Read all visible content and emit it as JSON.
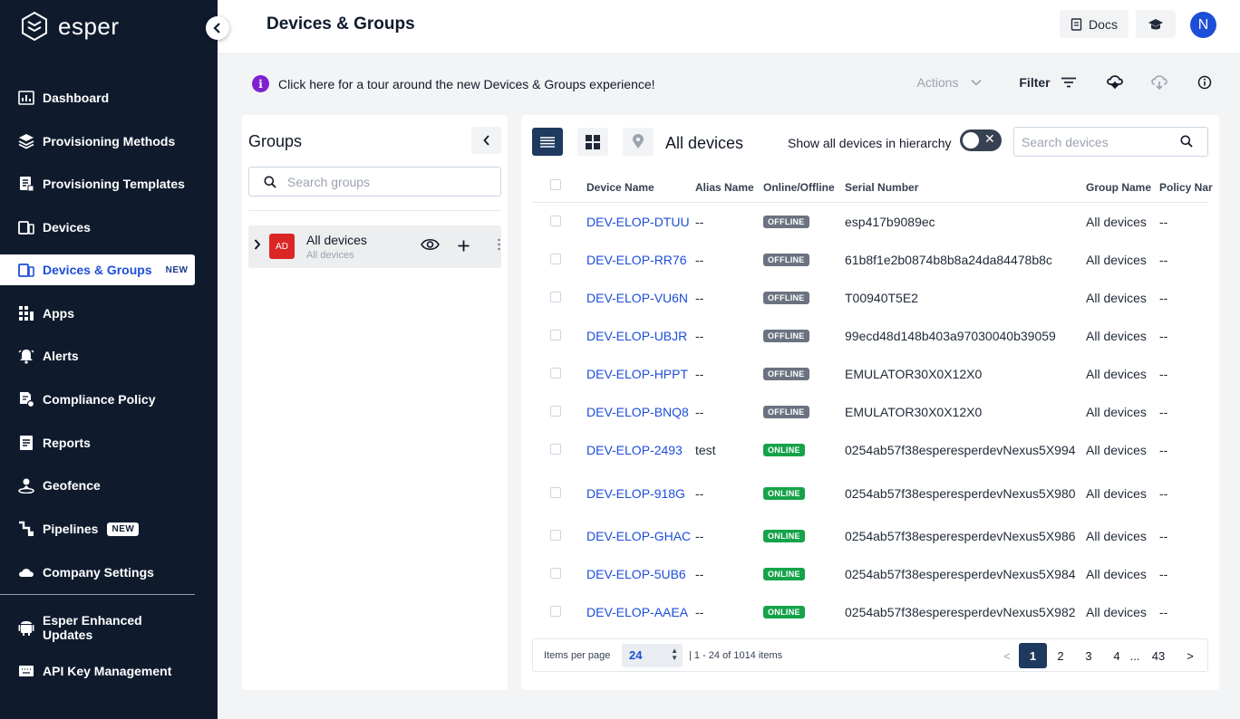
{
  "sidebar": {
    "logo": "esper",
    "items": [
      {
        "label": "Dashboard",
        "icon": "dashboard-icon"
      },
      {
        "label": "Provisioning Methods",
        "icon": "layers-icon"
      },
      {
        "label": "Provisioning Templates",
        "icon": "template-icon"
      },
      {
        "label": "Devices",
        "icon": "devices-icon"
      },
      {
        "label": "Devices & Groups",
        "icon": "devices-groups-icon",
        "badge": "NEW",
        "active": true
      },
      {
        "label": "Apps",
        "icon": "apps-icon"
      },
      {
        "label": "Alerts",
        "icon": "bell-icon"
      },
      {
        "label": "Compliance Policy",
        "icon": "policy-icon"
      },
      {
        "label": "Reports",
        "icon": "reports-icon"
      },
      {
        "label": "Geofence",
        "icon": "geofence-icon"
      },
      {
        "label": "Pipelines",
        "icon": "pipelines-icon",
        "badge": "NEW"
      },
      {
        "label": "Company Settings",
        "icon": "cloud-icon"
      }
    ],
    "bottom_items": [
      {
        "label": "Esper Enhanced Updates",
        "icon": "android-icon"
      },
      {
        "label": "API Key Management",
        "icon": "keyboard-icon"
      }
    ]
  },
  "header": {
    "title": "Devices & Groups",
    "docs_label": "Docs",
    "avatar_initial": "N"
  },
  "toolbar": {
    "tour_text": "Click here for a tour around the new Devices & Groups experience!",
    "actions_label": "Actions",
    "filter_label": "Filter"
  },
  "groups": {
    "title": "Groups",
    "search_placeholder": "Search groups",
    "items": [
      {
        "avatar": "AD",
        "name": "All devices",
        "sub": "All devices"
      }
    ]
  },
  "devices": {
    "title": "All devices",
    "hierarchy_label": "Show all devices in hierarchy",
    "search_placeholder": "Search devices",
    "columns": [
      "Device Name",
      "Alias Name",
      "Online/Offline",
      "Serial Number",
      "Group Name",
      "Policy Nar"
    ],
    "rows": [
      {
        "name": "DEV-ELOP-DTUU",
        "alias": "--",
        "status": "OFFLINE",
        "serial": "esp417b9089ec",
        "group": "All devices",
        "policy": "--"
      },
      {
        "name": "DEV-ELOP-RR76",
        "alias": "--",
        "status": "OFFLINE",
        "serial": "61b8f1e2b0874b8b8a24da84478b8c",
        "group": "All devices",
        "policy": "--"
      },
      {
        "name": "DEV-ELOP-VU6N",
        "alias": "--",
        "status": "OFFLINE",
        "serial": "T00940T5E2",
        "group": "All devices",
        "policy": "--"
      },
      {
        "name": "DEV-ELOP-UBJR",
        "alias": "--",
        "status": "OFFLINE",
        "serial": "99ecd48d148b403a97030040b39059",
        "group": "All devices",
        "policy": "--"
      },
      {
        "name": "DEV-ELOP-HPPT",
        "alias": "--",
        "status": "OFFLINE",
        "serial": "EMULATOR30X0X12X0",
        "group": "All devices",
        "policy": "--"
      },
      {
        "name": "DEV-ELOP-BNQ8",
        "alias": "--",
        "status": "OFFLINE",
        "serial": "EMULATOR30X0X12X0",
        "group": "All devices",
        "policy": "--"
      },
      {
        "name": "DEV-ELOP-2493",
        "alias": "test",
        "status": "ONLINE",
        "serial": "0254ab57f38esperesperdevNexus5X994",
        "group": "All devices",
        "policy": "--"
      },
      {
        "name": "DEV-ELOP-918G",
        "alias": "--",
        "status": "ONLINE",
        "serial": "0254ab57f38esperesperdevNexus5X980",
        "group": "All devices",
        "policy": "--"
      },
      {
        "name": "DEV-ELOP-GHAC",
        "alias": "--",
        "status": "ONLINE",
        "serial": "0254ab57f38esperesperdevNexus5X986",
        "group": "All devices",
        "policy": "--"
      },
      {
        "name": "DEV-ELOP-5UB6",
        "alias": "--",
        "status": "ONLINE",
        "serial": "0254ab57f38esperesperdevNexus5X984",
        "group": "All devices",
        "policy": "--"
      },
      {
        "name": "DEV-ELOP-AAEA",
        "alias": "--",
        "status": "ONLINE",
        "serial": "0254ab57f38esperesperdevNexus5X982",
        "group": "All devices",
        "policy": "--"
      }
    ]
  },
  "pagination": {
    "items_per_page_label": "Items per page",
    "items_per_page": "24",
    "range_text": "| 1 - 24 of 1014 items",
    "prev": "<",
    "pages": [
      "1",
      "2",
      "3",
      "4",
      "...",
      "43"
    ],
    "next": ">",
    "current": "1"
  },
  "colors": {
    "sidebar_bg": "#0f1b2d",
    "accent": "#1d4ed8",
    "offline": "#6b7280",
    "online": "#16a34a"
  }
}
